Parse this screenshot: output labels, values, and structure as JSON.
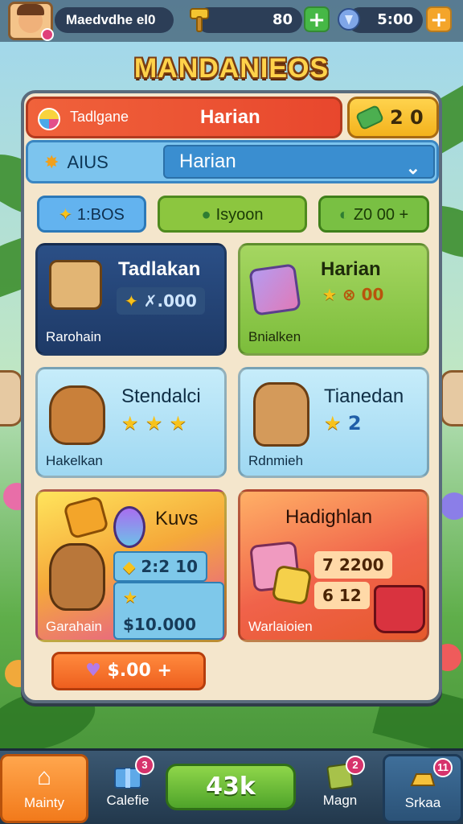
{
  "hud": {
    "player_name": "Maedvdhe el0",
    "coins": "80",
    "gems": "5:00",
    "plus": "+"
  },
  "title": "MANDANIEOS",
  "header": {
    "label": "Tadlgane",
    "title": "Harian",
    "gold_value": "2 0"
  },
  "filter": {
    "label": "AIUS",
    "selected": "Harian",
    "chevron": "⌄"
  },
  "chips": [
    {
      "label": "1:BOS"
    },
    {
      "label": "Isyoon"
    },
    {
      "label": "Z0 00 +"
    }
  ],
  "cards": [
    {
      "title": "Tadlakan",
      "value": "✗.000",
      "subtitle": "Rarohain"
    },
    {
      "title": "Harian",
      "value": "⊗ 00",
      "subtitle": "Bnialken"
    },
    {
      "title": "Stendalci",
      "value": "",
      "subtitle": "Hakelkan"
    },
    {
      "title": "Tianedan",
      "value": "2",
      "subtitle": "Rdnmieh"
    },
    {
      "title": "Kuvs",
      "value1": "2:2 10",
      "value2": "$10.000",
      "subtitle": "Garahain"
    },
    {
      "title": "Hadighlan",
      "value1": "7 2200",
      "value2": "6 12",
      "subtitle": "Warlaioien"
    }
  ],
  "bottom_button": {
    "label": "$.00 +"
  },
  "nav": {
    "home": "Mainty",
    "cards": "Calefie",
    "cards_badge": "3",
    "center_value": "43k",
    "magic": "Magn",
    "magic_badge": "2",
    "shop": "Srkaa",
    "shop_badge": "11"
  },
  "colors": {
    "accent_orange": "#f0623b",
    "accent_blue": "#3a8ed0",
    "accent_green": "#7cbd3b",
    "gold": "#ffd24a"
  }
}
